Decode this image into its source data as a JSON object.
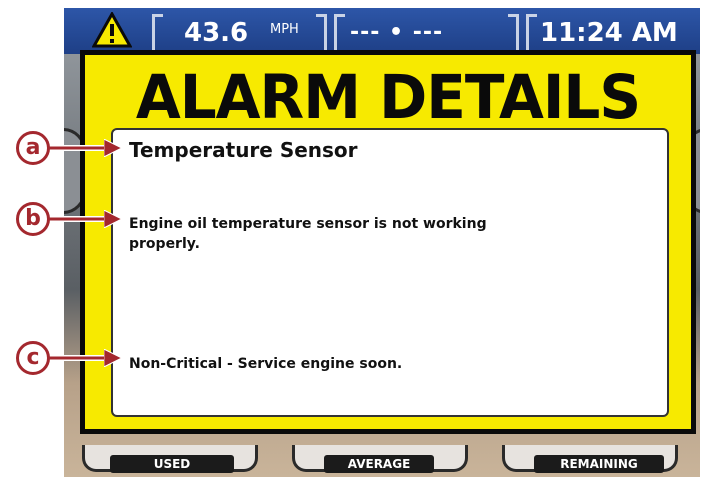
{
  "status_bar": {
    "speed": "43.6",
    "speed_unit": "MPH",
    "trip": "--- • ---",
    "time": "11:24 AM"
  },
  "alarm": {
    "title": "ALARM DETAILS",
    "sensor_name": "Temperature Sensor",
    "description": "Engine oil temperature sensor is not working properly.",
    "severity": "Non-Critical - Service engine soon."
  },
  "soft_buttons": [
    {
      "label": "USED"
    },
    {
      "label": "AVERAGE"
    },
    {
      "label": "REMAINING"
    }
  ],
  "callouts": [
    {
      "letter": "a"
    },
    {
      "letter": "b"
    },
    {
      "letter": "c"
    }
  ],
  "colors": {
    "alarm_background": "#f7ea00",
    "callout": "#a4282e",
    "status_bar": "#1e3f86"
  }
}
